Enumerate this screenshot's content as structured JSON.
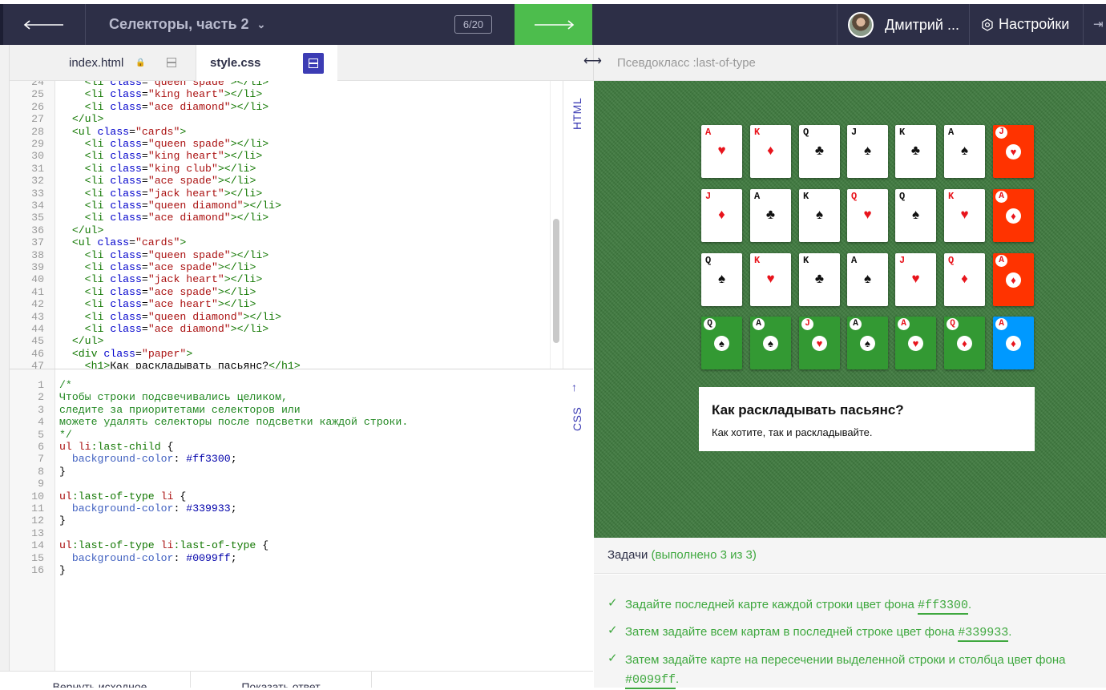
{
  "topbar": {
    "lesson_title": "Селекторы, часть 2",
    "progress": "6/20",
    "user_name": "Дмитрий ...",
    "settings_label": "Настройки"
  },
  "tabs": {
    "html_label": "index.html",
    "css_label": "style.css"
  },
  "side_labels": {
    "html": "HTML",
    "css": "CSS"
  },
  "html_code": [
    {
      "n": "24",
      "parts": [
        [
          "t-txt",
          "    "
        ],
        [
          "t-tag",
          "<li "
        ],
        [
          "t-attr",
          "class"
        ],
        [
          "t-txt",
          "="
        ],
        [
          "t-str",
          "\"queen spade\""
        ],
        [
          "t-tag",
          "></li>"
        ]
      ]
    },
    {
      "n": "25",
      "parts": [
        [
          "t-txt",
          "    "
        ],
        [
          "t-tag",
          "<li "
        ],
        [
          "t-attr",
          "class"
        ],
        [
          "t-txt",
          "="
        ],
        [
          "t-str",
          "\"king heart\""
        ],
        [
          "t-tag",
          "></li>"
        ]
      ]
    },
    {
      "n": "26",
      "parts": [
        [
          "t-txt",
          "    "
        ],
        [
          "t-tag",
          "<li "
        ],
        [
          "t-attr",
          "class"
        ],
        [
          "t-txt",
          "="
        ],
        [
          "t-str",
          "\"ace diamond\""
        ],
        [
          "t-tag",
          "></li>"
        ]
      ]
    },
    {
      "n": "27",
      "parts": [
        [
          "t-txt",
          "  "
        ],
        [
          "t-tag",
          "</ul>"
        ]
      ]
    },
    {
      "n": "28",
      "parts": [
        [
          "t-txt",
          "  "
        ],
        [
          "t-tag",
          "<ul "
        ],
        [
          "t-attr",
          "class"
        ],
        [
          "t-txt",
          "="
        ],
        [
          "t-str",
          "\"cards\""
        ],
        [
          "t-tag",
          ">"
        ]
      ]
    },
    {
      "n": "29",
      "parts": [
        [
          "t-txt",
          "    "
        ],
        [
          "t-tag",
          "<li "
        ],
        [
          "t-attr",
          "class"
        ],
        [
          "t-txt",
          "="
        ],
        [
          "t-str",
          "\"queen spade\""
        ],
        [
          "t-tag",
          "></li>"
        ]
      ]
    },
    {
      "n": "30",
      "parts": [
        [
          "t-txt",
          "    "
        ],
        [
          "t-tag",
          "<li "
        ],
        [
          "t-attr",
          "class"
        ],
        [
          "t-txt",
          "="
        ],
        [
          "t-str",
          "\"king heart\""
        ],
        [
          "t-tag",
          "></li>"
        ]
      ]
    },
    {
      "n": "31",
      "parts": [
        [
          "t-txt",
          "    "
        ],
        [
          "t-tag",
          "<li "
        ],
        [
          "t-attr",
          "class"
        ],
        [
          "t-txt",
          "="
        ],
        [
          "t-str",
          "\"king club\""
        ],
        [
          "t-tag",
          "></li>"
        ]
      ]
    },
    {
      "n": "32",
      "parts": [
        [
          "t-txt",
          "    "
        ],
        [
          "t-tag",
          "<li "
        ],
        [
          "t-attr",
          "class"
        ],
        [
          "t-txt",
          "="
        ],
        [
          "t-str",
          "\"ace spade\""
        ],
        [
          "t-tag",
          "></li>"
        ]
      ]
    },
    {
      "n": "33",
      "parts": [
        [
          "t-txt",
          "    "
        ],
        [
          "t-tag",
          "<li "
        ],
        [
          "t-attr",
          "class"
        ],
        [
          "t-txt",
          "="
        ],
        [
          "t-str",
          "\"jack heart\""
        ],
        [
          "t-tag",
          "></li>"
        ]
      ]
    },
    {
      "n": "34",
      "parts": [
        [
          "t-txt",
          "    "
        ],
        [
          "t-tag",
          "<li "
        ],
        [
          "t-attr",
          "class"
        ],
        [
          "t-txt",
          "="
        ],
        [
          "t-str",
          "\"queen diamond\""
        ],
        [
          "t-tag",
          "></li>"
        ]
      ]
    },
    {
      "n": "35",
      "parts": [
        [
          "t-txt",
          "    "
        ],
        [
          "t-tag",
          "<li "
        ],
        [
          "t-attr",
          "class"
        ],
        [
          "t-txt",
          "="
        ],
        [
          "t-str",
          "\"ace diamond\""
        ],
        [
          "t-tag",
          "></li>"
        ]
      ]
    },
    {
      "n": "36",
      "parts": [
        [
          "t-txt",
          "  "
        ],
        [
          "t-tag",
          "</ul>"
        ]
      ]
    },
    {
      "n": "37",
      "parts": [
        [
          "t-txt",
          "  "
        ],
        [
          "t-tag",
          "<ul "
        ],
        [
          "t-attr",
          "class"
        ],
        [
          "t-txt",
          "="
        ],
        [
          "t-str",
          "\"cards\""
        ],
        [
          "t-tag",
          ">"
        ]
      ]
    },
    {
      "n": "38",
      "parts": [
        [
          "t-txt",
          "    "
        ],
        [
          "t-tag",
          "<li "
        ],
        [
          "t-attr",
          "class"
        ],
        [
          "t-txt",
          "="
        ],
        [
          "t-str",
          "\"queen spade\""
        ],
        [
          "t-tag",
          "></li>"
        ]
      ]
    },
    {
      "n": "39",
      "parts": [
        [
          "t-txt",
          "    "
        ],
        [
          "t-tag",
          "<li "
        ],
        [
          "t-attr",
          "class"
        ],
        [
          "t-txt",
          "="
        ],
        [
          "t-str",
          "\"ace spade\""
        ],
        [
          "t-tag",
          "></li>"
        ]
      ]
    },
    {
      "n": "40",
      "parts": [
        [
          "t-txt",
          "    "
        ],
        [
          "t-tag",
          "<li "
        ],
        [
          "t-attr",
          "class"
        ],
        [
          "t-txt",
          "="
        ],
        [
          "t-str",
          "\"jack heart\""
        ],
        [
          "t-tag",
          "></li>"
        ]
      ]
    },
    {
      "n": "41",
      "parts": [
        [
          "t-txt",
          "    "
        ],
        [
          "t-tag",
          "<li "
        ],
        [
          "t-attr",
          "class"
        ],
        [
          "t-txt",
          "="
        ],
        [
          "t-str",
          "\"ace spade\""
        ],
        [
          "t-tag",
          "></li>"
        ]
      ]
    },
    {
      "n": "42",
      "parts": [
        [
          "t-txt",
          "    "
        ],
        [
          "t-tag",
          "<li "
        ],
        [
          "t-attr",
          "class"
        ],
        [
          "t-txt",
          "="
        ],
        [
          "t-str",
          "\"ace heart\""
        ],
        [
          "t-tag",
          "></li>"
        ]
      ]
    },
    {
      "n": "43",
      "parts": [
        [
          "t-txt",
          "    "
        ],
        [
          "t-tag",
          "<li "
        ],
        [
          "t-attr",
          "class"
        ],
        [
          "t-txt",
          "="
        ],
        [
          "t-str",
          "\"queen diamond\""
        ],
        [
          "t-tag",
          "></li>"
        ]
      ]
    },
    {
      "n": "44",
      "parts": [
        [
          "t-txt",
          "    "
        ],
        [
          "t-tag",
          "<li "
        ],
        [
          "t-attr",
          "class"
        ],
        [
          "t-txt",
          "="
        ],
        [
          "t-str",
          "\"ace diamond\""
        ],
        [
          "t-tag",
          "></li>"
        ]
      ]
    },
    {
      "n": "45",
      "parts": [
        [
          "t-txt",
          "  "
        ],
        [
          "t-tag",
          "</ul>"
        ]
      ]
    },
    {
      "n": "46",
      "parts": [
        [
          "t-txt",
          "  "
        ],
        [
          "t-tag",
          "<div "
        ],
        [
          "t-attr",
          "class"
        ],
        [
          "t-txt",
          "="
        ],
        [
          "t-str",
          "\"paper\""
        ],
        [
          "t-tag",
          ">"
        ]
      ]
    },
    {
      "n": "47",
      "parts": [
        [
          "t-txt",
          "    "
        ],
        [
          "t-tag",
          "<h1>"
        ],
        [
          "t-txt",
          "Как раскладывать пасьянс?"
        ],
        [
          "t-tag",
          "</h1>"
        ]
      ]
    }
  ],
  "css_code": [
    {
      "n": "1",
      "parts": [
        [
          "c-com",
          "/*"
        ]
      ]
    },
    {
      "n": "2",
      "parts": [
        [
          "c-com",
          "Чтобы строки подсвечивались целиком,"
        ]
      ]
    },
    {
      "n": "3",
      "parts": [
        [
          "c-com",
          "следите за приоритетами селекторов или"
        ]
      ]
    },
    {
      "n": "4",
      "parts": [
        [
          "c-com",
          "можете удалять селекторы после подсветки каждой строки."
        ]
      ]
    },
    {
      "n": "5",
      "parts": [
        [
          "c-com",
          "*/"
        ]
      ]
    },
    {
      "n": "6",
      "parts": [
        [
          "c-sel2",
          "ul li"
        ],
        [
          "c-sel",
          ":last-child"
        ],
        [
          "t-txt",
          " {"
        ]
      ]
    },
    {
      "n": "7",
      "parts": [
        [
          "t-txt",
          "  "
        ],
        [
          "c-prop",
          "background-color"
        ],
        [
          "t-txt",
          ": "
        ],
        [
          "c-val",
          "#ff3300"
        ],
        [
          "t-txt",
          ";"
        ]
      ]
    },
    {
      "n": "8",
      "parts": [
        [
          "t-txt",
          "}"
        ]
      ]
    },
    {
      "n": "9",
      "parts": []
    },
    {
      "n": "10",
      "parts": [
        [
          "c-sel2",
          "ul"
        ],
        [
          "c-sel",
          ":last-of-type"
        ],
        [
          "c-sel2",
          " li"
        ],
        [
          "t-txt",
          " {"
        ]
      ]
    },
    {
      "n": "11",
      "parts": [
        [
          "t-txt",
          "  "
        ],
        [
          "c-prop",
          "background-color"
        ],
        [
          "t-txt",
          ": "
        ],
        [
          "c-val",
          "#339933"
        ],
        [
          "t-txt",
          ";"
        ]
      ]
    },
    {
      "n": "12",
      "parts": [
        [
          "t-txt",
          "}"
        ]
      ]
    },
    {
      "n": "13",
      "parts": []
    },
    {
      "n": "14",
      "parts": [
        [
          "c-sel2",
          "ul"
        ],
        [
          "c-sel",
          ":last-of-type"
        ],
        [
          "c-sel2",
          " li"
        ],
        [
          "c-sel",
          ":last-of-type"
        ],
        [
          "t-txt",
          " {"
        ]
      ]
    },
    {
      "n": "15",
      "parts": [
        [
          "t-txt",
          "  "
        ],
        [
          "c-prop",
          "background-color"
        ],
        [
          "t-txt",
          ": "
        ],
        [
          "c-val",
          "#0099ff"
        ],
        [
          "t-txt",
          ";"
        ]
      ]
    },
    {
      "n": "16",
      "parts": [
        [
          "t-txt",
          "}"
        ]
      ]
    }
  ],
  "bottom_buttons": {
    "reset": "Вернуть исходное",
    "show": "Показать ответ"
  },
  "right_header": {
    "topic": "Псевдокласс :last-of-type"
  },
  "preview": {
    "rows": [
      [
        {
          "r": "A",
          "s": "♥",
          "c": "red"
        },
        {
          "r": "K",
          "s": "♦",
          "c": "red"
        },
        {
          "r": "Q",
          "s": "♣",
          "c": "black"
        },
        {
          "r": "J",
          "s": "♠",
          "c": "black"
        },
        {
          "r": "K",
          "s": "♣",
          "c": "black"
        },
        {
          "r": "A",
          "s": "♠",
          "c": "black"
        },
        {
          "r": "J",
          "s": "♥",
          "c": "red",
          "bg": "red"
        }
      ],
      [
        {
          "r": "J",
          "s": "♦",
          "c": "red"
        },
        {
          "r": "A",
          "s": "♣",
          "c": "black"
        },
        {
          "r": "K",
          "s": "♠",
          "c": "black"
        },
        {
          "r": "Q",
          "s": "♥",
          "c": "red"
        },
        {
          "r": "Q",
          "s": "♠",
          "c": "black"
        },
        {
          "r": "K",
          "s": "♥",
          "c": "red"
        },
        {
          "r": "A",
          "s": "♦",
          "c": "red",
          "bg": "red"
        }
      ],
      [
        {
          "r": "Q",
          "s": "♠",
          "c": "black"
        },
        {
          "r": "K",
          "s": "♥",
          "c": "red"
        },
        {
          "r": "K",
          "s": "♣",
          "c": "black"
        },
        {
          "r": "A",
          "s": "♠",
          "c": "black"
        },
        {
          "r": "J",
          "s": "♥",
          "c": "red"
        },
        {
          "r": "Q",
          "s": "♦",
          "c": "red"
        },
        {
          "r": "A",
          "s": "♦",
          "c": "red",
          "bg": "red"
        }
      ],
      [
        {
          "r": "Q",
          "s": "♠",
          "c": "black",
          "bg": "green"
        },
        {
          "r": "A",
          "s": "♠",
          "c": "black",
          "bg": "green"
        },
        {
          "r": "J",
          "s": "♥",
          "c": "red",
          "bg": "green"
        },
        {
          "r": "A",
          "s": "♠",
          "c": "black",
          "bg": "green"
        },
        {
          "r": "A",
          "s": "♥",
          "c": "red",
          "bg": "green"
        },
        {
          "r": "Q",
          "s": "♦",
          "c": "red",
          "bg": "green"
        },
        {
          "r": "A",
          "s": "♦",
          "c": "red",
          "bg": "blue"
        }
      ]
    ],
    "paper_title": "Как раскладывать пасьянс?",
    "paper_text": "Как хотите, так и раскладывайте."
  },
  "tasks": {
    "title": "Задачи",
    "status": "(выполнено 3 из 3)",
    "items": [
      {
        "text": "Задайте последней карте каждой строки цвет фона ",
        "code": "#ff3300",
        "after": "."
      },
      {
        "text": "Затем задайте всем картам в последней строке цвет фона ",
        "code": "#339933",
        "after": "."
      },
      {
        "text": "Затем задайте карте на пересечении выделенной строки и столбца цвет фона ",
        "code": "#0099ff",
        "after": "."
      }
    ]
  },
  "colors": {
    "red": "#ff3300",
    "green": "#339933",
    "blue": "#0099ff",
    "accent": "#3c3cb4",
    "success": "#4dbd4d"
  }
}
